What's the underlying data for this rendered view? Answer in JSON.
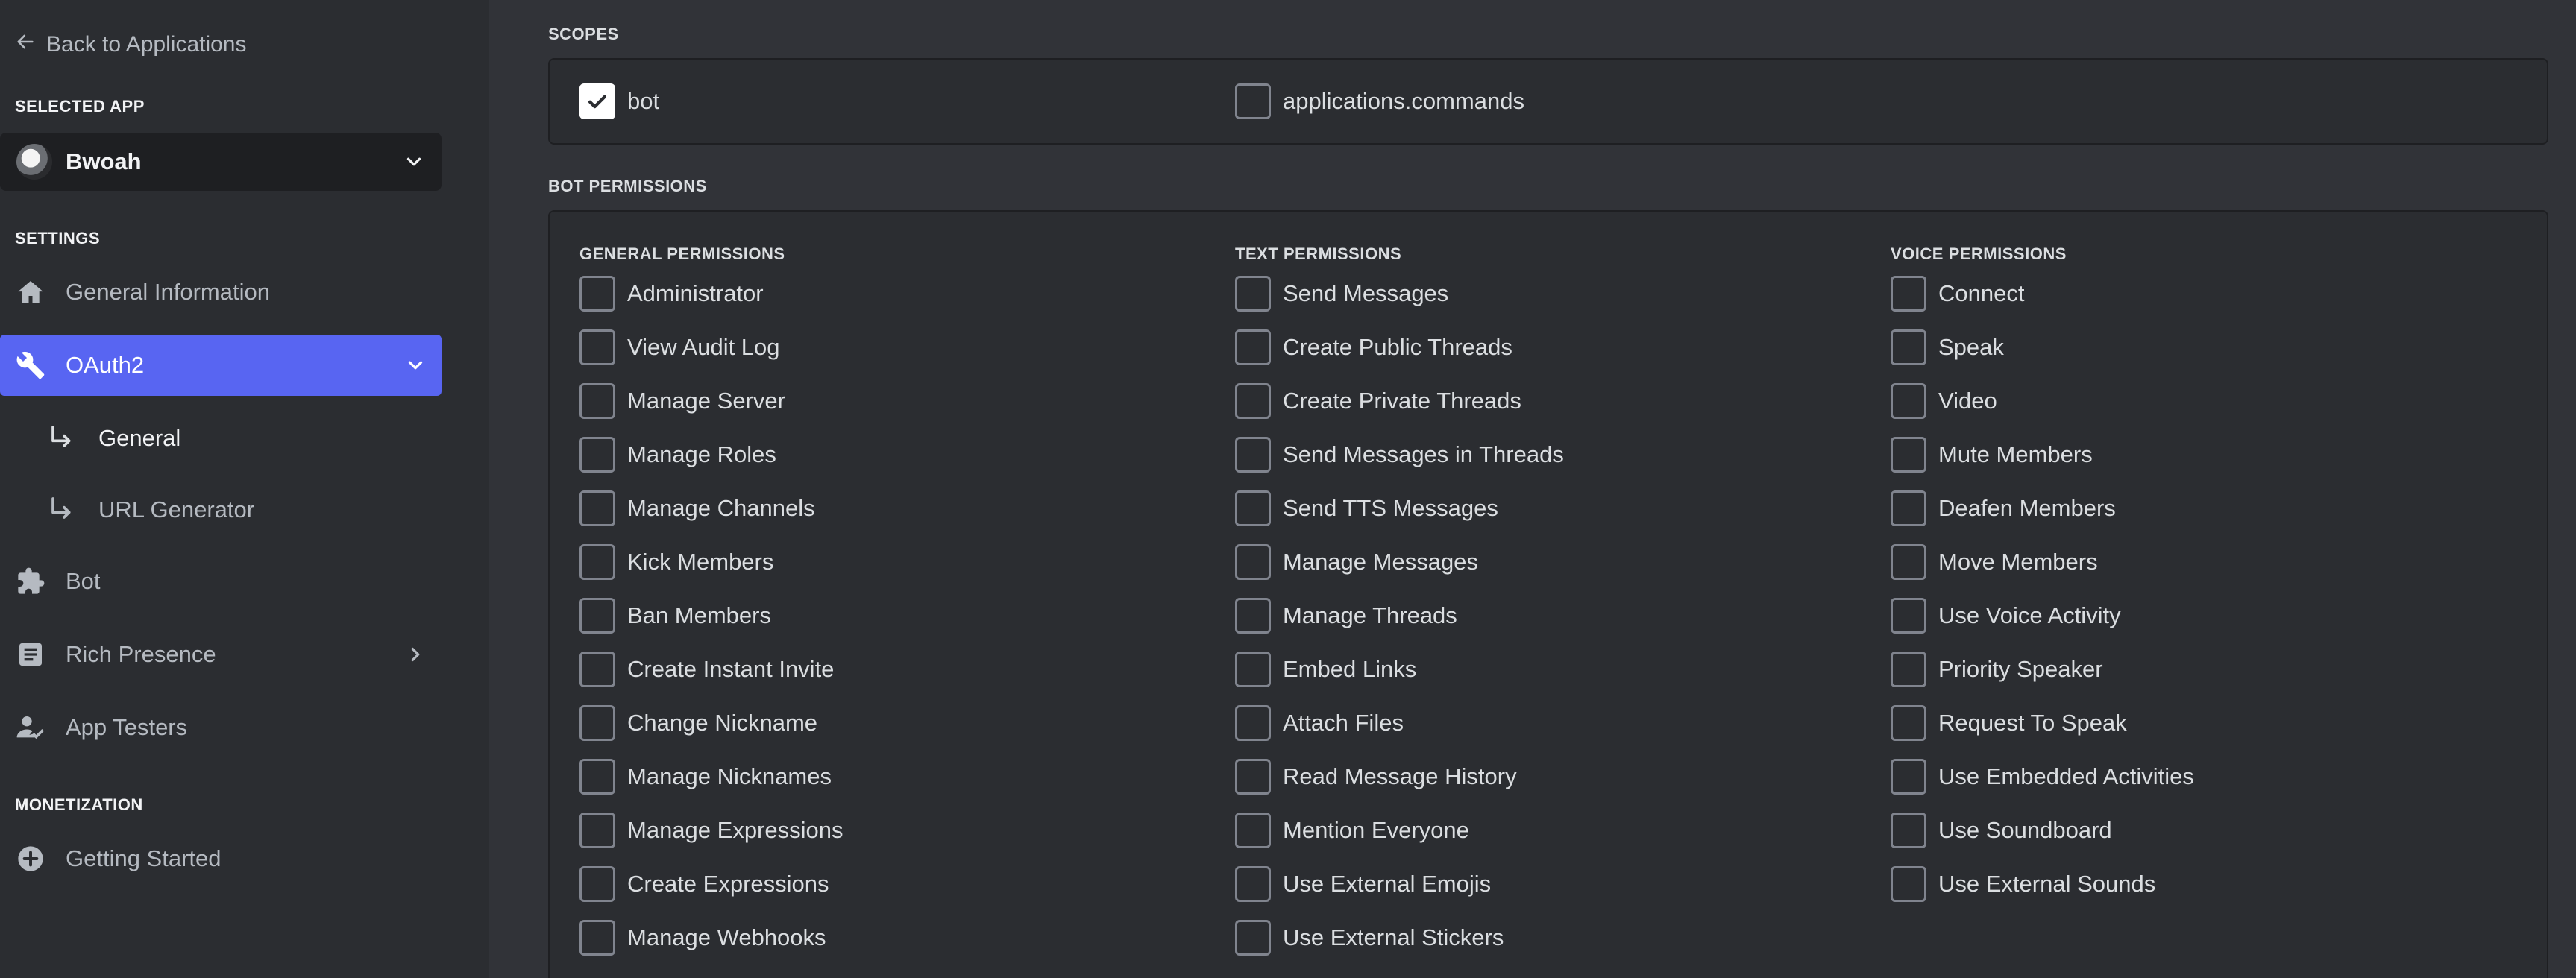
{
  "sidebar": {
    "back_label": "Back to Applications",
    "selected_app_heading": "SELECTED APP",
    "app_name": "Bwoah",
    "settings_heading": "SETTINGS",
    "monetization_heading": "MONETIZATION",
    "items": [
      {
        "label": "General Information",
        "icon": "home-icon"
      },
      {
        "label": "OAuth2",
        "icon": "wrench-icon",
        "active": true
      },
      {
        "label": "General",
        "icon": "sub-arrow-icon"
      },
      {
        "label": "URL Generator",
        "icon": "sub-arrow-icon"
      },
      {
        "label": "Bot",
        "icon": "puzzle-icon"
      },
      {
        "label": "Rich Presence",
        "icon": "document-icon"
      },
      {
        "label": "App Testers",
        "icon": "person-icon"
      },
      {
        "label": "Getting Started",
        "icon": "plus-circle-icon"
      }
    ]
  },
  "scopes": {
    "heading": "SCOPES",
    "items": [
      {
        "label": "bot",
        "checked": true
      },
      {
        "label": "applications.commands",
        "checked": false
      }
    ]
  },
  "bot_permissions": {
    "heading": "BOT PERMISSIONS",
    "columns": [
      {
        "title": "GENERAL PERMISSIONS",
        "items": [
          "Administrator",
          "View Audit Log",
          "Manage Server",
          "Manage Roles",
          "Manage Channels",
          "Kick Members",
          "Ban Members",
          "Create Instant Invite",
          "Change Nickname",
          "Manage Nicknames",
          "Manage Expressions",
          "Create Expressions",
          "Manage Webhooks"
        ]
      },
      {
        "title": "TEXT PERMISSIONS",
        "items": [
          "Send Messages",
          "Create Public Threads",
          "Create Private Threads",
          "Send Messages in Threads",
          "Send TTS Messages",
          "Manage Messages",
          "Manage Threads",
          "Embed Links",
          "Attach Files",
          "Read Message History",
          "Mention Everyone",
          "Use External Emojis",
          "Use External Stickers"
        ]
      },
      {
        "title": "VOICE PERMISSIONS",
        "items": [
          "Connect",
          "Speak",
          "Video",
          "Mute Members",
          "Deafen Members",
          "Move Members",
          "Use Voice Activity",
          "Priority Speaker",
          "Request To Speak",
          "Use Embedded Activities",
          "Use Soundboard",
          "Use External Sounds"
        ]
      }
    ]
  },
  "colors": {
    "accent": "#5865f2",
    "sidebar_bg": "#2b2d31",
    "main_bg": "#313338",
    "panel_border": "#1e1f22"
  }
}
